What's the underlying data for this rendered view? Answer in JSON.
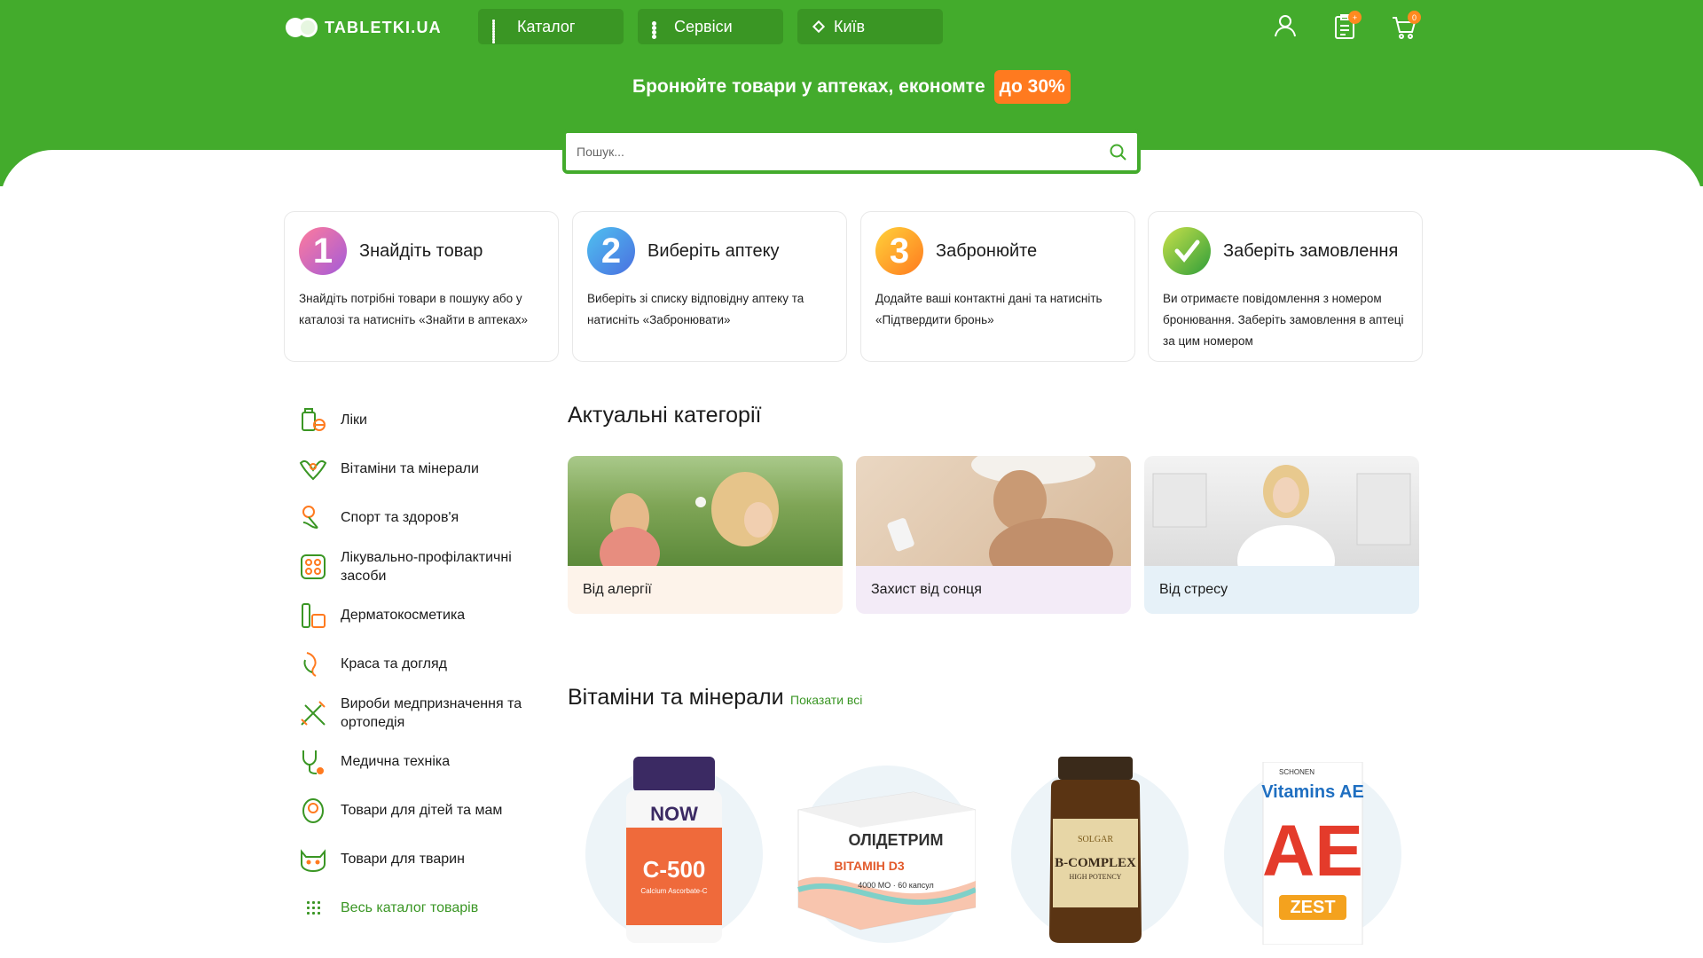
{
  "header": {
    "logo_text": "TABLETKI.UA",
    "catalog_label": "Каталог",
    "services_label": "Сервіси",
    "city_label": "Київ",
    "reservations_badge": "+",
    "cart_badge": "0"
  },
  "promo": {
    "text": "Бронюйте товари у аптеках, економте",
    "badge": "до 30%"
  },
  "search": {
    "placeholder": "Пошук..."
  },
  "steps": [
    {
      "num": "1",
      "title": "Знайдіть товар",
      "text": "Знайдіть потрібні товари в пошуку або у каталозі та натисніть «Знайти в аптеках»"
    },
    {
      "num": "2",
      "title": "Виберіть аптеку",
      "text": "Виберіть зі списку відповідну аптеку та натисніть «Забронювати»"
    },
    {
      "num": "3",
      "title": "Забронюйте",
      "text": "Додайте ваші контактні дані та натисніть «Підтвердити бронь»"
    },
    {
      "num": "",
      "title": "Заберіть замовлення",
      "text": "Ви отримаєте повідомлення з номером бронювання. Заберіть замовлення в аптеці за цим номером"
    }
  ],
  "sidebar": {
    "items": [
      {
        "label": "Ліки",
        "icon": "pills-icon"
      },
      {
        "label": "Вітаміни та мінерали",
        "icon": "vitamins-icon"
      },
      {
        "label": "Спорт та здоров'я",
        "icon": "sport-icon"
      },
      {
        "label": "Лікувально-профілактичні засоби",
        "icon": "prophylactic-icon"
      },
      {
        "label": "Дерматокосметика",
        "icon": "cosmetics-icon"
      },
      {
        "label": "Краса та догляд",
        "icon": "beauty-icon"
      },
      {
        "label": "Вироби медпризначення та ортопедія",
        "icon": "orthopedics-icon"
      },
      {
        "label": "Медична техніка",
        "icon": "stethoscope-icon"
      },
      {
        "label": "Товари для дітей та мам",
        "icon": "baby-icon"
      },
      {
        "label": "Товари для тварин",
        "icon": "cat-icon"
      }
    ],
    "all_catalog": "Весь каталог товарів"
  },
  "categories": {
    "title": "Актуальні категорії",
    "items": [
      {
        "label": "Від алергії",
        "bg": "#fdf3ea"
      },
      {
        "label": "Захист від сонця",
        "bg": "#f3ebf7"
      },
      {
        "label": "Від стресу",
        "bg": "#e6f1f8"
      }
    ]
  },
  "vitamins": {
    "title": "Вітаміни та мінерали",
    "show_all": "Показати всі",
    "products": [
      {
        "brand": "NOW",
        "name": "C-500",
        "sub": "Calcium Ascorbate-C"
      },
      {
        "brand": "ОЛІДЕТРИМ",
        "name": "ВІТАМІН D3",
        "sub": "4000 МО · 60 капсул"
      },
      {
        "brand": "SOLGAR",
        "name": "B-COMPLEX",
        "sub": "HIGH POTENCY"
      },
      {
        "brand": "SCHONEN",
        "name": "Vitamins AE",
        "sub": "ZEST"
      }
    ]
  },
  "colors": {
    "brand_green": "#43ab2c",
    "accent_orange": "#ff7a1f"
  }
}
